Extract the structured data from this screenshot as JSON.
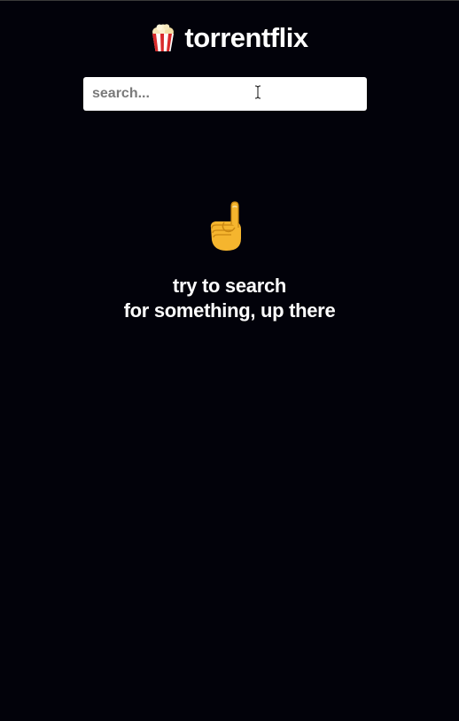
{
  "header": {
    "title": "torrentflix",
    "logo_icon": "popcorn-icon"
  },
  "search": {
    "placeholder": "search...",
    "value": ""
  },
  "empty_state": {
    "icon": "pointing-up-hand-icon",
    "line1": "try to search",
    "line2": "for something, up there"
  },
  "colors": {
    "background": "#02020a",
    "text": "#ffffff",
    "input_background": "#ffffff",
    "placeholder": "#7a7a7a"
  }
}
